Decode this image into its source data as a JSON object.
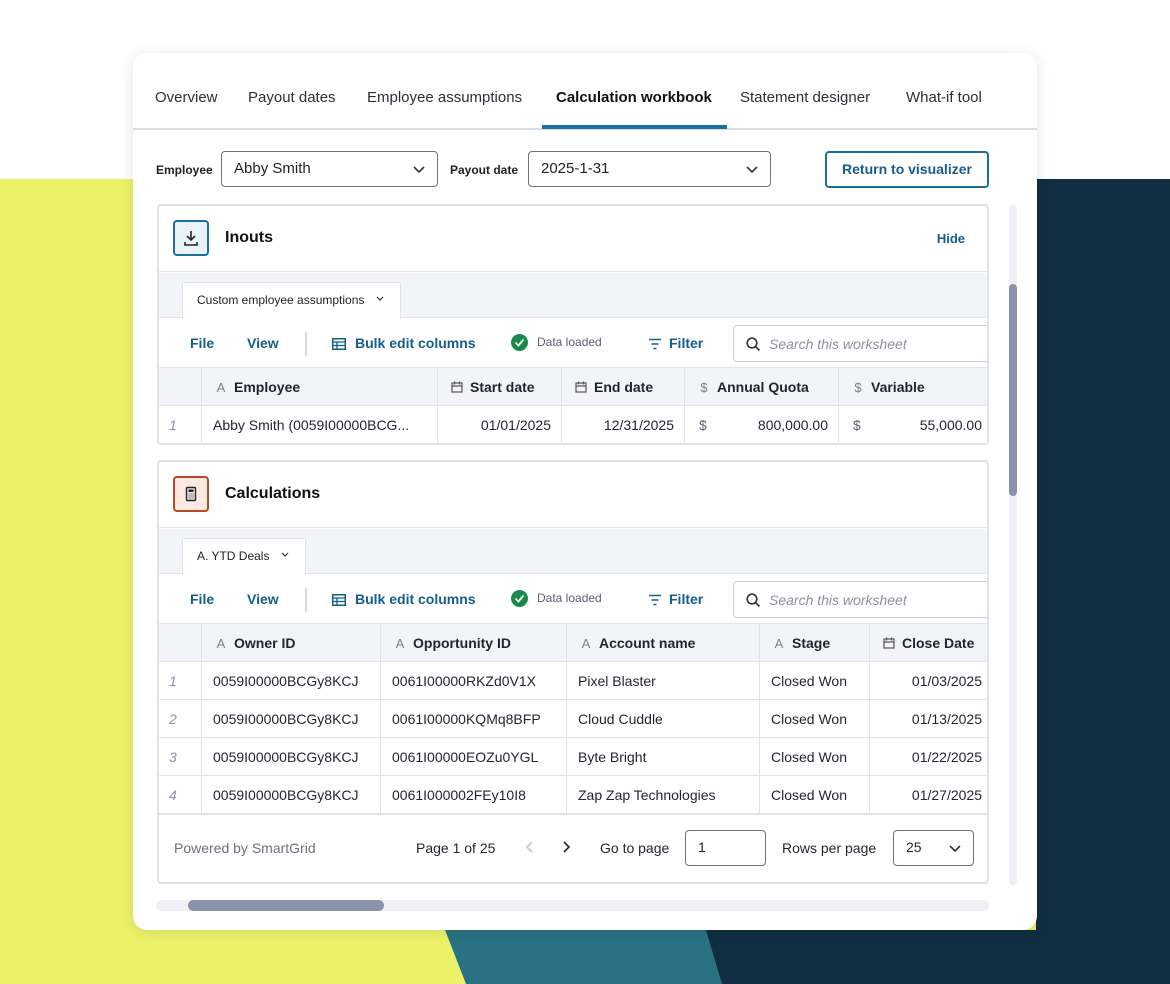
{
  "tabs": [
    {
      "label": "Overview"
    },
    {
      "label": "Payout dates"
    },
    {
      "label": "Employee assumptions"
    },
    {
      "label": "Calculation workbook"
    },
    {
      "label": "Statement designer"
    },
    {
      "label": "What-if tool"
    }
  ],
  "active_tab": "Calculation workbook",
  "filters": {
    "employee_label": "Employee",
    "employee_value": "Abby Smith",
    "payout_label": "Payout date",
    "payout_value": "2025-1-31",
    "return_button": "Return to visualizer"
  },
  "inputs_panel": {
    "title": "Inouts",
    "hide_label": "Hide",
    "sheet_tab": "Custom employee assumptions",
    "toolbar": {
      "file": "File",
      "view": "View",
      "bulk_edit": "Bulk edit columns",
      "status": "Data loaded",
      "filter": "Filter",
      "search_placeholder": "Search this worksheet"
    },
    "columns": [
      "Employee",
      "Start date",
      "End date",
      "Annual Quota",
      "Variable"
    ],
    "rows": [
      {
        "num": "1",
        "employee": "Abby Smith (0059I00000BCG...",
        "start": "01/01/2025",
        "end": "12/31/2025",
        "quota_cur": "$",
        "quota": "800,000.00",
        "var_cur": "$",
        "variable": "55,000.00"
      }
    ]
  },
  "calc_panel": {
    "title": "Calculations",
    "sheet_tab": "A. YTD Deals",
    "toolbar": {
      "file": "File",
      "view": "View",
      "bulk_edit": "Bulk edit columns",
      "status": "Data loaded",
      "filter": "Filter",
      "search_placeholder": "Search this worksheet"
    },
    "columns": [
      "Owner ID",
      "Opportunity ID",
      "Account name",
      "Stage",
      "Close Date"
    ],
    "rows": [
      {
        "num": "1",
        "owner": "0059I00000BCGy8KCJ",
        "opp": "0061I00000RKZd0V1X",
        "account": "Pixel Blaster",
        "stage": "Closed Won",
        "close": "01/03/2025"
      },
      {
        "num": "2",
        "owner": "0059I00000BCGy8KCJ",
        "opp": "0061I00000KQMq8BFP",
        "account": "Cloud Cuddle",
        "stage": "Closed Won",
        "close": "01/13/2025"
      },
      {
        "num": "3",
        "owner": "0059I00000BCGy8KCJ",
        "opp": "0061I00000EOZu0YGL",
        "account": "Byte Bright",
        "stage": "Closed Won",
        "close": "01/22/2025"
      },
      {
        "num": "4",
        "owner": "0059I00000BCGy8KCJ",
        "opp": "0061I000002FEy10I8",
        "account": "Zap Zap Technologies",
        "stage": "Closed Won",
        "close": "01/27/2025"
      }
    ],
    "footer": {
      "powered": "Powered by SmartGrid",
      "page_info": "Page 1 of 25",
      "goto_label": "Go to page",
      "goto_value": "1",
      "rpp_label": "Rows per page",
      "rpp_value": "25"
    }
  },
  "colors": {
    "accent": "#1a6fa0",
    "yellow": "#ecf268",
    "navy": "#102d42",
    "teal": "#287283",
    "success": "#1a8a4a"
  }
}
